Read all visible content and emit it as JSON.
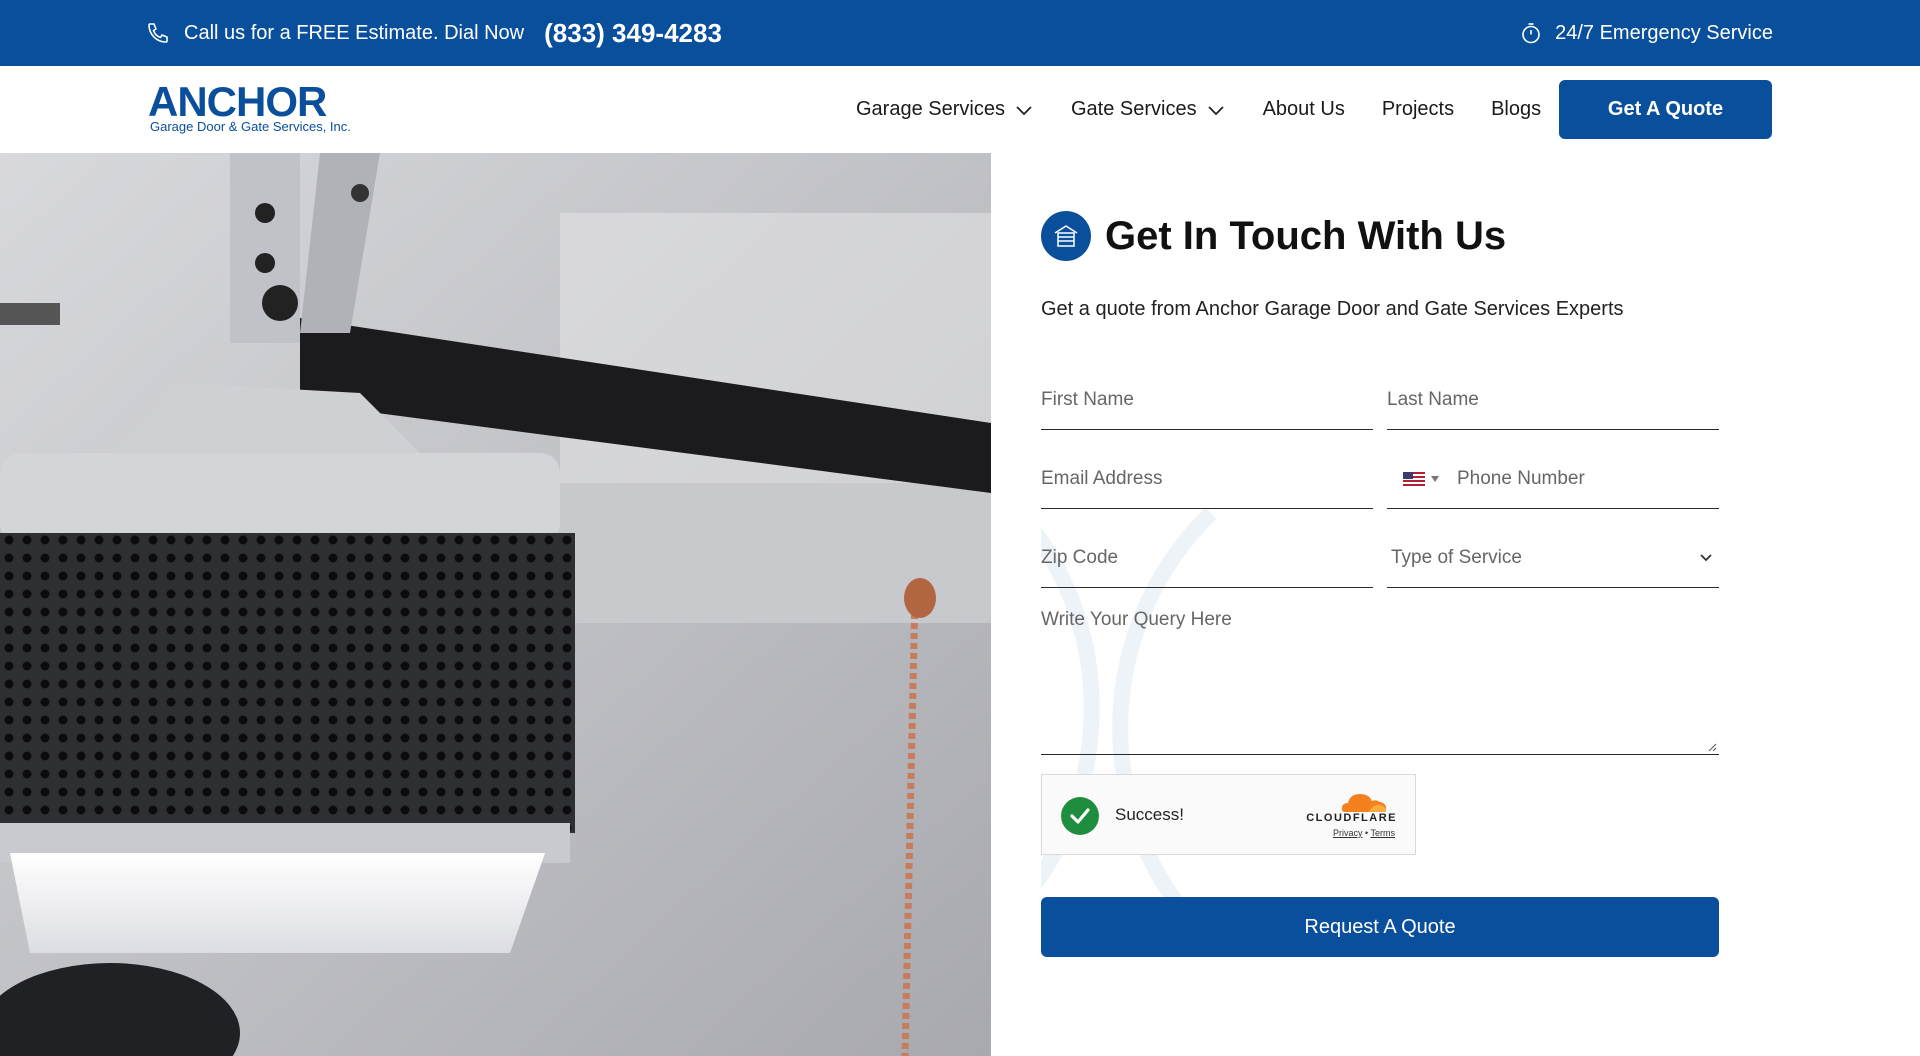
{
  "topbar": {
    "call_text": "Call us for a FREE Estimate. Dial Now",
    "phone": "(833) 349-4283",
    "emergency": "24/7 Emergency Service"
  },
  "header": {
    "logo_word": "ANCHOR",
    "logo_sub": "Garage Door & Gate Services, Inc.",
    "nav": {
      "garage_services": "Garage Services",
      "gate_services": "Gate Services",
      "about": "About Us",
      "projects": "Projects",
      "blogs": "Blogs"
    },
    "quote_button": "Get A Quote"
  },
  "form": {
    "title": "Get In Touch With Us",
    "subtitle": "Get a quote from Anchor Garage Door and Gate Services Experts",
    "first_name": "First Name",
    "last_name": "Last Name",
    "email": "Email Address",
    "phone": "Phone Number",
    "zip": "Zip Code",
    "service_type": "Type of Service",
    "query": "Write Your Query Here",
    "captcha": {
      "status": "Success!",
      "brand": "CLOUDFLARE",
      "privacy": "Privacy",
      "separator": "•",
      "terms": "Terms"
    },
    "submit": "Request A Quote"
  },
  "colors": {
    "brand_blue": "#0a4f9c",
    "success_green": "#1e8e3e",
    "cloudflare_orange": "#f48120"
  }
}
